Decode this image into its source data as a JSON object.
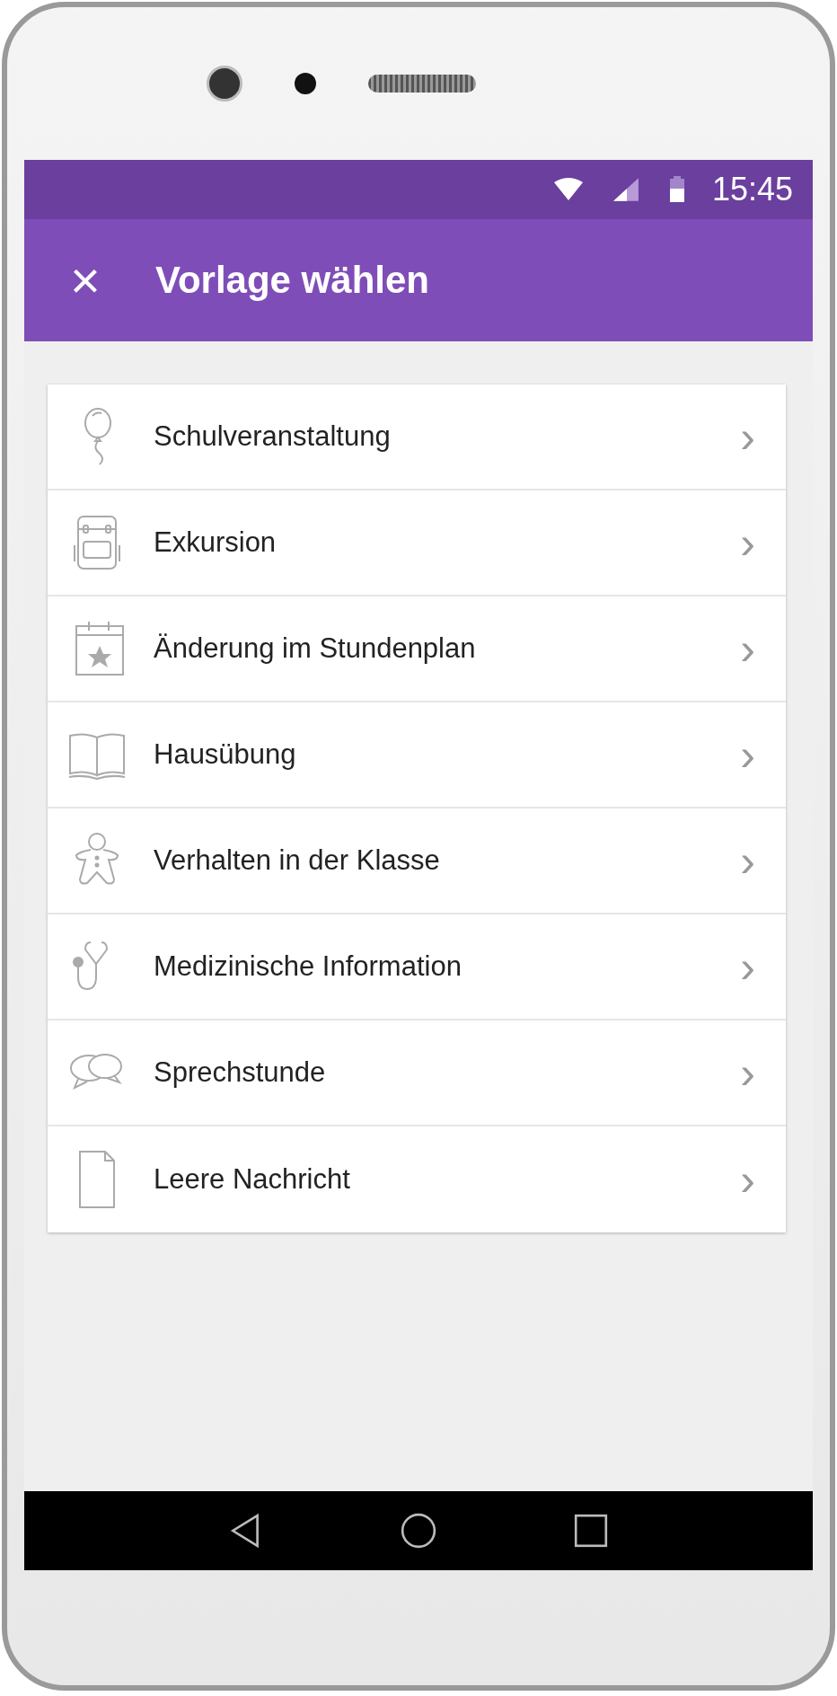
{
  "status_bar": {
    "time": "15:45"
  },
  "app_bar": {
    "close": "×",
    "title": "Vorlage wählen"
  },
  "templates": [
    {
      "label": "Schulveranstaltung",
      "chevron": "›"
    },
    {
      "label": "Exkursion",
      "chevron": "›"
    },
    {
      "label": "Änderung im Stundenplan",
      "chevron": "›"
    },
    {
      "label": "Hausübung",
      "chevron": "›"
    },
    {
      "label": "Verhalten in der Klasse",
      "chevron": "›"
    },
    {
      "label": "Medizinische Information",
      "chevron": "›"
    },
    {
      "label": "Sprechstunde",
      "chevron": "›"
    },
    {
      "label": "Leere Nachricht",
      "chevron": "›"
    }
  ]
}
